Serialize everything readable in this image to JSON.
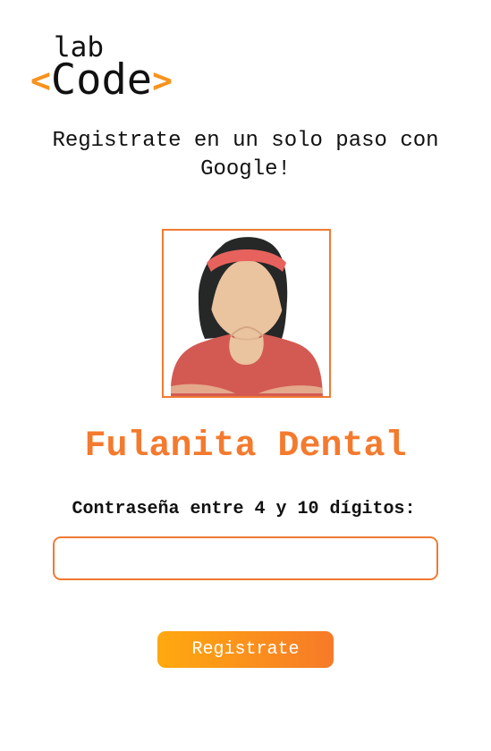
{
  "logo": {
    "top_text": "lab",
    "open_bracket": "<",
    "main_text": "Code",
    "close_bracket": ">"
  },
  "headline": "Registrate en un solo paso con Google!",
  "profile": {
    "avatar_icon": "female-user-avatar-icon",
    "name": "Fulanita Dental"
  },
  "password": {
    "label": "Contraseña entre 4 y 10 dígitos:",
    "value": "",
    "placeholder": ""
  },
  "register_button": {
    "label": "Registrate"
  },
  "colors": {
    "accent": "#f47a2e",
    "button_start": "#ffa90f",
    "button_end": "#f77a28",
    "text": "#111111"
  }
}
